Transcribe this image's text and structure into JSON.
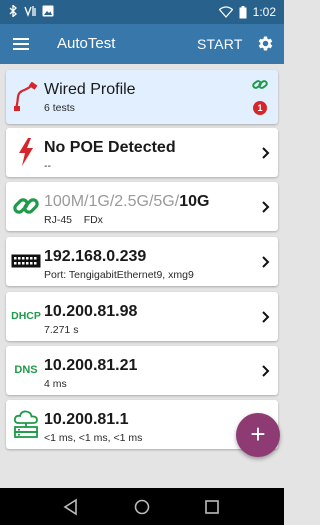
{
  "status_bar": {
    "time": "1:02",
    "left_icons": [
      "bluetooth-icon",
      "signal-icon",
      "image-icon"
    ],
    "right_icons": [
      "wifi-icon",
      "battery-icon"
    ]
  },
  "app_bar": {
    "title": "AutoTest",
    "start_label": "START",
    "menu_icon": "menu-icon",
    "settings_icon": "gear-icon"
  },
  "cards": {
    "profile": {
      "title": "Wired Profile",
      "subtitle": "6 tests",
      "badge_count": "1",
      "icon": "ethernet-cable-icon",
      "link_icon": "link-icon"
    },
    "poe": {
      "title": "No POE Detected",
      "subtitle": "--",
      "icon": "lightning-icon"
    },
    "link": {
      "speeds_dim": "100M/1G/2.5G/5G/",
      "speed_active": "10G",
      "connector": "RJ-45",
      "duplex": "FDx",
      "icon": "link-icon"
    },
    "switch": {
      "title": "192.168.0.239",
      "subtitle": "Port:  TengigabitEthernet9, xmg9",
      "icon": "switch-icon"
    },
    "dhcp": {
      "icon_label": "DHCP",
      "title": "10.200.81.98",
      "subtitle": "7.271 s"
    },
    "dns": {
      "icon_label": "DNS",
      "title": "10.200.81.21",
      "subtitle": "4 ms"
    },
    "gateway": {
      "title": "10.200.81.1",
      "subtitle": "<1 ms,  <1 ms,  <1 ms",
      "icon": "cloud-server-icon"
    }
  },
  "fab": {
    "label": "+"
  },
  "colors": {
    "status_bar": "#28618c",
    "app_bar": "#3777a9",
    "highlight_card": "#e1efff",
    "red": "#d7262b",
    "green": "#1f9a4a",
    "fab": "#8e3b74"
  }
}
